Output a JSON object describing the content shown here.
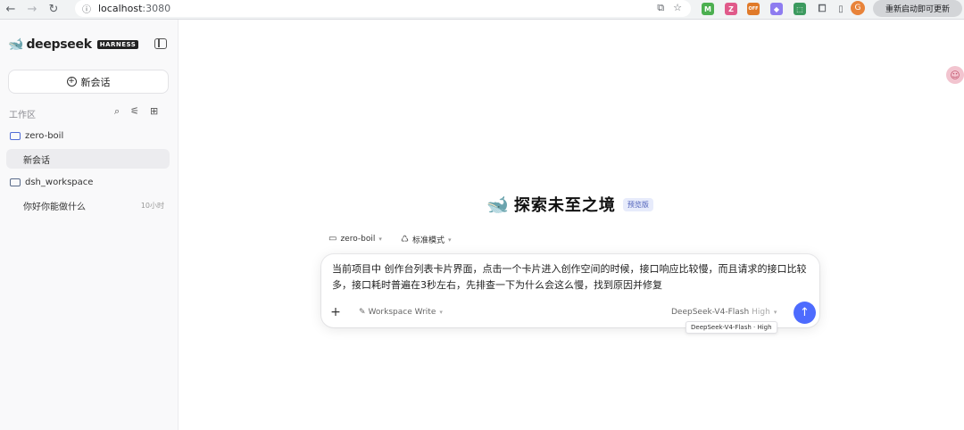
{
  "browser": {
    "url_host": "localhost",
    "url_port": ":3080",
    "update_label": "重新启动即可更新",
    "profile_initial": "G",
    "extensions": [
      {
        "label": "M",
        "color": "#4caf50"
      },
      {
        "label": "Z",
        "color": "#e05a8a"
      },
      {
        "label": "OFF",
        "color": "#e07a2a"
      },
      {
        "label": "◆",
        "color": "#8e7cf0"
      },
      {
        "label": "⬚",
        "color": "#3c9a5f"
      }
    ]
  },
  "sidebar": {
    "brand_name": "deepseek",
    "brand_tag": "HARNESS",
    "new_chat_label": "新会话",
    "workspace_label": "工作区",
    "folders": [
      {
        "name": "zero-boil",
        "items": [
          {
            "label": "新会话",
            "time": "",
            "selected": true
          }
        ]
      },
      {
        "name": "dsh_workspace",
        "items": [
          {
            "label": "你好你能做什么",
            "time": "10小时",
            "selected": false
          }
        ]
      }
    ]
  },
  "main": {
    "hero_title": "探索未至之境",
    "hero_badge": "预览版",
    "project_select": "zero-boil",
    "mode_select": "标准模式",
    "prompt_text": "当前项目中 创作台列表卡片界面，点击一个卡片进入创作空间的时候，接口响应比较慢，而且请求的接口比较多，接口耗时普遍在3秒左右，先排查一下为什么会这么慢，找到原因并修复",
    "workspace_mode": "Workspace Write",
    "model_name": "DeepSeek-V4-Flash",
    "model_level": "High",
    "tooltip": "DeepSeek-V4-Flash · High"
  },
  "colors": {
    "accent": "#4d6bfe",
    "badge_bg": "#e7ebfb"
  }
}
